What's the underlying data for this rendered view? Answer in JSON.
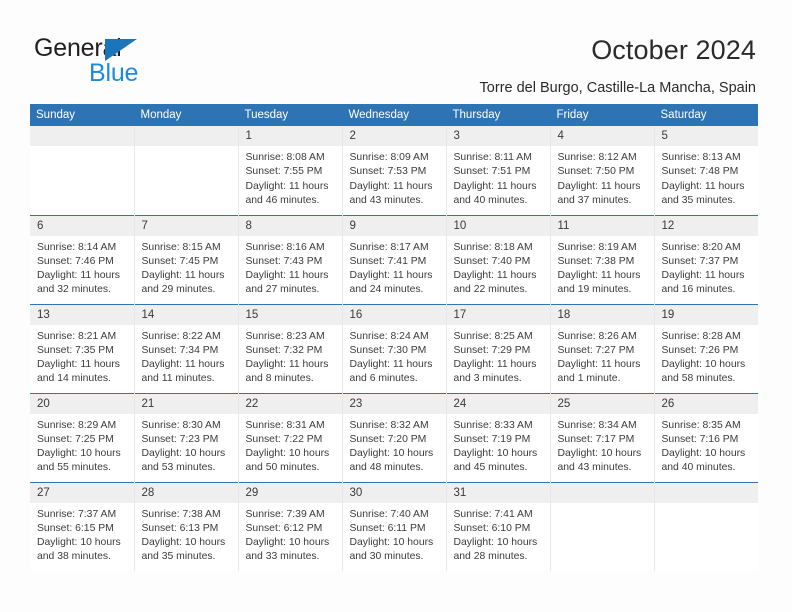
{
  "logo": {
    "word1": "General",
    "word2": "Blue",
    "triangle_icon": "triangle-right-icon"
  },
  "header": {
    "month_title": "October 2024",
    "location": "Torre del Burgo, Castille-La Mancha, Spain",
    "accent_color": "#2e74b5",
    "daynum_band_color": "#efefef"
  },
  "calendar": {
    "weekday_headers": [
      "Sunday",
      "Monday",
      "Tuesday",
      "Wednesday",
      "Thursday",
      "Friday",
      "Saturday"
    ],
    "labels": {
      "sunrise": "Sunrise:",
      "sunset": "Sunset:",
      "daylight": "Daylight:"
    },
    "weeks": [
      [
        {
          "day": ""
        },
        {
          "day": ""
        },
        {
          "day": "1",
          "sunrise": "Sunrise: 8:08 AM",
          "sunset": "Sunset: 7:55 PM",
          "daylight": "Daylight: 11 hours and 46 minutes."
        },
        {
          "day": "2",
          "sunrise": "Sunrise: 8:09 AM",
          "sunset": "Sunset: 7:53 PM",
          "daylight": "Daylight: 11 hours and 43 minutes."
        },
        {
          "day": "3",
          "sunrise": "Sunrise: 8:11 AM",
          "sunset": "Sunset: 7:51 PM",
          "daylight": "Daylight: 11 hours and 40 minutes."
        },
        {
          "day": "4",
          "sunrise": "Sunrise: 8:12 AM",
          "sunset": "Sunset: 7:50 PM",
          "daylight": "Daylight: 11 hours and 37 minutes."
        },
        {
          "day": "5",
          "sunrise": "Sunrise: 8:13 AM",
          "sunset": "Sunset: 7:48 PM",
          "daylight": "Daylight: 11 hours and 35 minutes."
        }
      ],
      [
        {
          "day": "6",
          "sunrise": "Sunrise: 8:14 AM",
          "sunset": "Sunset: 7:46 PM",
          "daylight": "Daylight: 11 hours and 32 minutes."
        },
        {
          "day": "7",
          "sunrise": "Sunrise: 8:15 AM",
          "sunset": "Sunset: 7:45 PM",
          "daylight": "Daylight: 11 hours and 29 minutes."
        },
        {
          "day": "8",
          "sunrise": "Sunrise: 8:16 AM",
          "sunset": "Sunset: 7:43 PM",
          "daylight": "Daylight: 11 hours and 27 minutes."
        },
        {
          "day": "9",
          "sunrise": "Sunrise: 8:17 AM",
          "sunset": "Sunset: 7:41 PM",
          "daylight": "Daylight: 11 hours and 24 minutes."
        },
        {
          "day": "10",
          "sunrise": "Sunrise: 8:18 AM",
          "sunset": "Sunset: 7:40 PM",
          "daylight": "Daylight: 11 hours and 22 minutes."
        },
        {
          "day": "11",
          "sunrise": "Sunrise: 8:19 AM",
          "sunset": "Sunset: 7:38 PM",
          "daylight": "Daylight: 11 hours and 19 minutes."
        },
        {
          "day": "12",
          "sunrise": "Sunrise: 8:20 AM",
          "sunset": "Sunset: 7:37 PM",
          "daylight": "Daylight: 11 hours and 16 minutes."
        }
      ],
      [
        {
          "day": "13",
          "sunrise": "Sunrise: 8:21 AM",
          "sunset": "Sunset: 7:35 PM",
          "daylight": "Daylight: 11 hours and 14 minutes."
        },
        {
          "day": "14",
          "sunrise": "Sunrise: 8:22 AM",
          "sunset": "Sunset: 7:34 PM",
          "daylight": "Daylight: 11 hours and 11 minutes."
        },
        {
          "day": "15",
          "sunrise": "Sunrise: 8:23 AM",
          "sunset": "Sunset: 7:32 PM",
          "daylight": "Daylight: 11 hours and 8 minutes."
        },
        {
          "day": "16",
          "sunrise": "Sunrise: 8:24 AM",
          "sunset": "Sunset: 7:30 PM",
          "daylight": "Daylight: 11 hours and 6 minutes."
        },
        {
          "day": "17",
          "sunrise": "Sunrise: 8:25 AM",
          "sunset": "Sunset: 7:29 PM",
          "daylight": "Daylight: 11 hours and 3 minutes."
        },
        {
          "day": "18",
          "sunrise": "Sunrise: 8:26 AM",
          "sunset": "Sunset: 7:27 PM",
          "daylight": "Daylight: 11 hours and 1 minute."
        },
        {
          "day": "19",
          "sunrise": "Sunrise: 8:28 AM",
          "sunset": "Sunset: 7:26 PM",
          "daylight": "Daylight: 10 hours and 58 minutes."
        }
      ],
      [
        {
          "day": "20",
          "sunrise": "Sunrise: 8:29 AM",
          "sunset": "Sunset: 7:25 PM",
          "daylight": "Daylight: 10 hours and 55 minutes."
        },
        {
          "day": "21",
          "sunrise": "Sunrise: 8:30 AM",
          "sunset": "Sunset: 7:23 PM",
          "daylight": "Daylight: 10 hours and 53 minutes."
        },
        {
          "day": "22",
          "sunrise": "Sunrise: 8:31 AM",
          "sunset": "Sunset: 7:22 PM",
          "daylight": "Daylight: 10 hours and 50 minutes."
        },
        {
          "day": "23",
          "sunrise": "Sunrise: 8:32 AM",
          "sunset": "Sunset: 7:20 PM",
          "daylight": "Daylight: 10 hours and 48 minutes."
        },
        {
          "day": "24",
          "sunrise": "Sunrise: 8:33 AM",
          "sunset": "Sunset: 7:19 PM",
          "daylight": "Daylight: 10 hours and 45 minutes."
        },
        {
          "day": "25",
          "sunrise": "Sunrise: 8:34 AM",
          "sunset": "Sunset: 7:17 PM",
          "daylight": "Daylight: 10 hours and 43 minutes."
        },
        {
          "day": "26",
          "sunrise": "Sunrise: 8:35 AM",
          "sunset": "Sunset: 7:16 PM",
          "daylight": "Daylight: 10 hours and 40 minutes."
        }
      ],
      [
        {
          "day": "27",
          "sunrise": "Sunrise: 7:37 AM",
          "sunset": "Sunset: 6:15 PM",
          "daylight": "Daylight: 10 hours and 38 minutes."
        },
        {
          "day": "28",
          "sunrise": "Sunrise: 7:38 AM",
          "sunset": "Sunset: 6:13 PM",
          "daylight": "Daylight: 10 hours and 35 minutes."
        },
        {
          "day": "29",
          "sunrise": "Sunrise: 7:39 AM",
          "sunset": "Sunset: 6:12 PM",
          "daylight": "Daylight: 10 hours and 33 minutes."
        },
        {
          "day": "30",
          "sunrise": "Sunrise: 7:40 AM",
          "sunset": "Sunset: 6:11 PM",
          "daylight": "Daylight: 10 hours and 30 minutes."
        },
        {
          "day": "31",
          "sunrise": "Sunrise: 7:41 AM",
          "sunset": "Sunset: 6:10 PM",
          "daylight": "Daylight: 10 hours and 28 minutes."
        },
        {
          "day": ""
        },
        {
          "day": ""
        }
      ]
    ]
  }
}
